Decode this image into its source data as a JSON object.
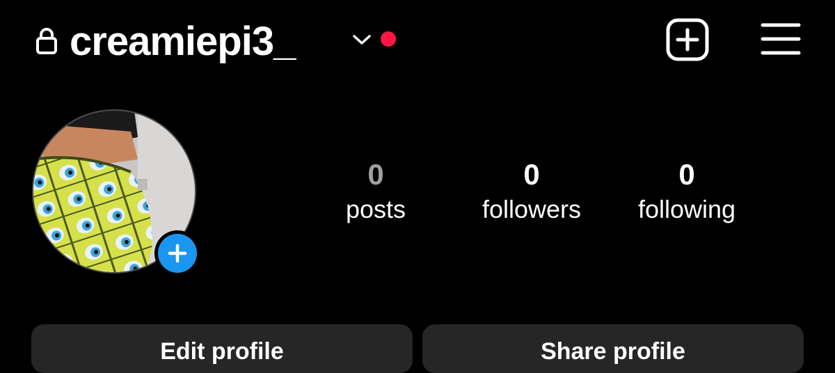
{
  "header": {
    "username": "creamiepi3_",
    "icons": {
      "lock": "lock-icon",
      "switch_account": "chevron-down-icon",
      "notification": "notification-dot",
      "create": "plus-square-icon",
      "menu": "hamburger-menu-icon"
    }
  },
  "profile": {
    "avatar": "profile-photo",
    "add_story_icon": "plus-icon"
  },
  "stats": [
    {
      "value": "0",
      "label": "posts"
    },
    {
      "value": "0",
      "label": "followers"
    },
    {
      "value": "0",
      "label": "following"
    }
  ],
  "actions": {
    "edit_profile": "Edit profile",
    "share_profile": "Share profile"
  },
  "colors": {
    "background": "#000000",
    "text": "#ffffff",
    "muted_number": "#a0a0a0",
    "notification_dot": "#ff1744",
    "accent_blue": "#1b96f0",
    "button_bg": "#262626"
  }
}
